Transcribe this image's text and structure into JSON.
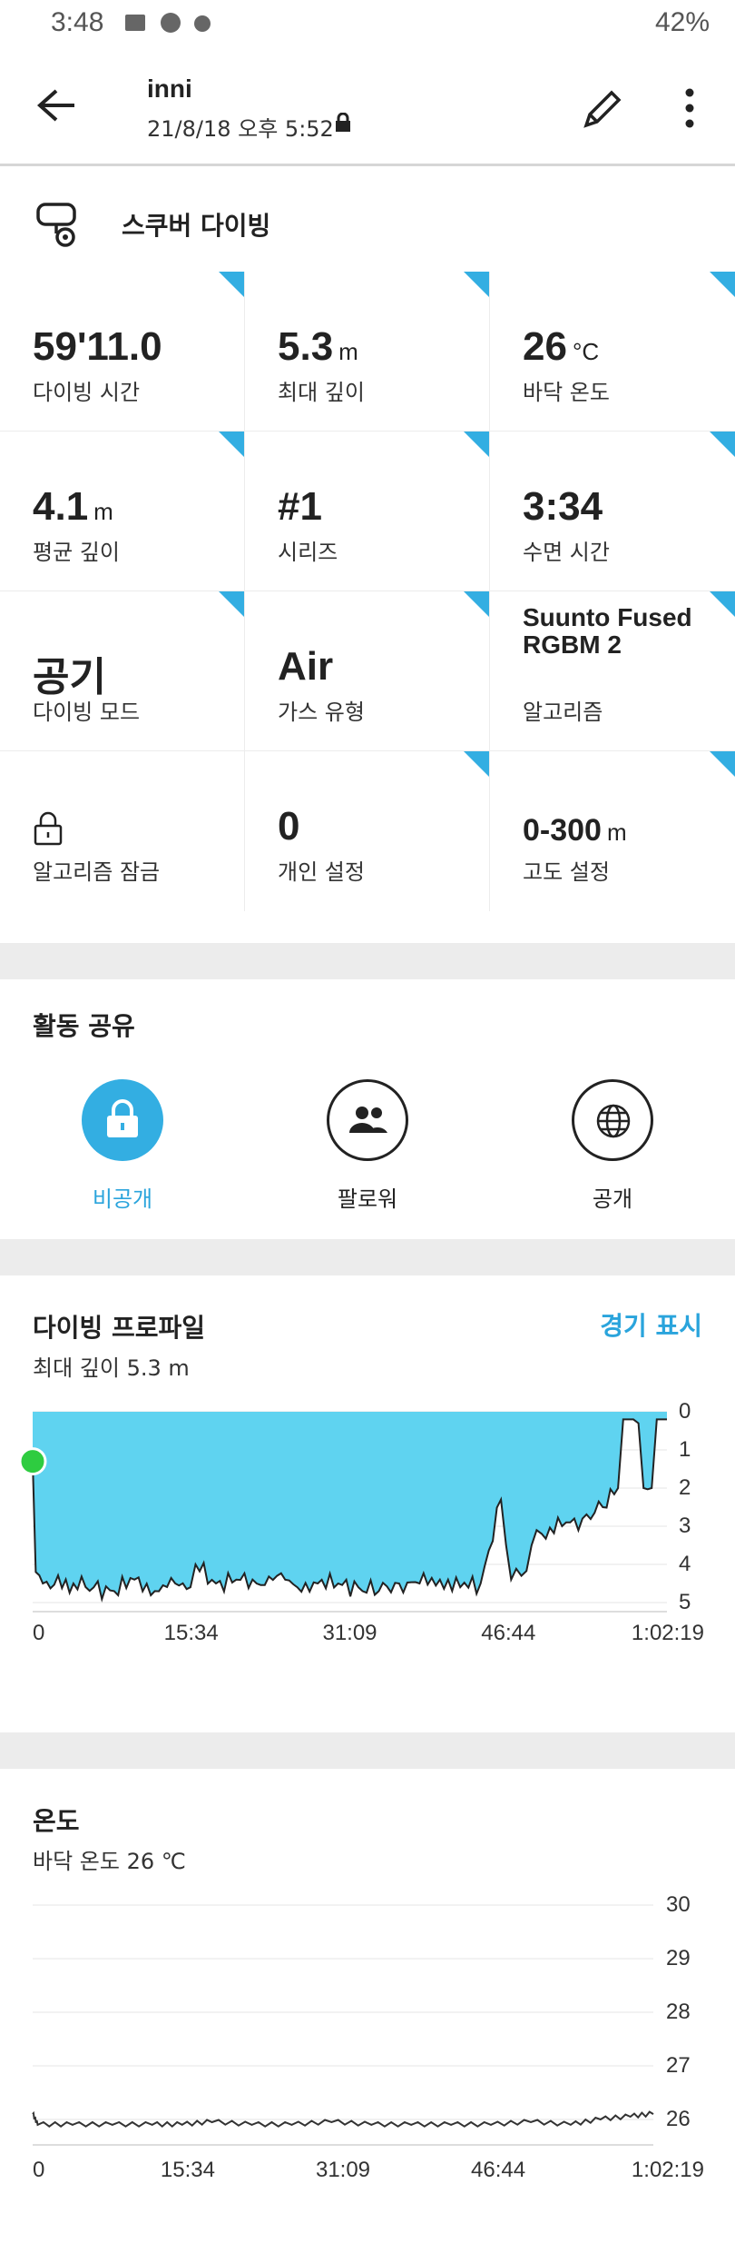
{
  "status_bar": {
    "time": "3:48",
    "battery": "42%"
  },
  "header": {
    "title": "inni",
    "subtitle": "21/8/18 오후 5:52"
  },
  "activity": {
    "name": "스쿠버 다이빙"
  },
  "stats": [
    {
      "value": "59'11.0",
      "unit": "",
      "label": "다이빙 시간"
    },
    {
      "value": "5.3",
      "unit": "m",
      "label": "최대 깊이"
    },
    {
      "value": "26",
      "unit": "°C",
      "label": "바닥 온도"
    },
    {
      "value": "4.1",
      "unit": "m",
      "label": "평균 깊이"
    },
    {
      "value": "#1",
      "unit": "",
      "label": "시리즈"
    },
    {
      "value": "3:34",
      "unit": "",
      "label": "수면 시간"
    },
    {
      "value": "공기",
      "unit": "",
      "label": "다이빙 모드"
    },
    {
      "value": "Air",
      "unit": "",
      "label": "가스 유형"
    },
    {
      "value": "Suunto Fused RGBM 2",
      "unit": "",
      "label": "알고리즘"
    },
    {
      "value": "",
      "unit": "",
      "label": "알고리즘 잠금"
    },
    {
      "value": "0",
      "unit": "",
      "label": "개인 설정"
    },
    {
      "value": "0-300",
      "unit": "m",
      "label": "고도 설정"
    }
  ],
  "share": {
    "title": "활동 공유",
    "options": [
      {
        "label": "비공개",
        "icon": "lock-icon",
        "selected": true
      },
      {
        "label": "팔로워",
        "icon": "people-icon",
        "selected": false
      },
      {
        "label": "공개",
        "icon": "globe-icon",
        "selected": false
      }
    ]
  },
  "dive_profile": {
    "title": "다이빙 프로파일",
    "subtitle": "최대 깊이 5.3 m",
    "action": "경기 표시"
  },
  "temperature": {
    "title": "온도",
    "subtitle": "바닥 온도 26 ℃"
  },
  "colors": {
    "accent": "#33aee2",
    "depth_fill": "#5fd3f0",
    "marker": "#2ecc40"
  },
  "chart_data": [
    {
      "type": "area",
      "title": "다이빙 프로파일",
      "x_ticks": [
        "0",
        "15:34",
        "31:09",
        "46:44",
        "1:02:19"
      ],
      "y_ticks": [
        "0",
        "1",
        "2",
        "3",
        "4",
        "5"
      ],
      "ylim": [
        5,
        0
      ],
      "x_minutes": [
        0,
        0.3,
        1,
        4,
        6,
        8,
        10,
        12,
        14,
        15.5,
        16,
        18,
        20,
        22,
        24,
        26,
        28,
        30,
        32,
        34,
        36,
        38,
        40,
        42,
        44,
        46,
        47,
        48,
        49,
        50,
        52,
        54,
        56,
        57.5,
        58,
        59,
        59.5,
        60,
        60.8,
        61.3,
        62.3
      ],
      "depth_m": [
        1.3,
        4.2,
        4.5,
        4.5,
        4.6,
        4.7,
        4.4,
        4.7,
        4.5,
        4.6,
        4.0,
        4.5,
        4.4,
        4.5,
        4.3,
        4.6,
        4.5,
        4.5,
        4.6,
        4.7,
        4.5,
        4.5,
        4.4,
        4.6,
        4.5,
        2.3,
        4.4,
        4.3,
        3.5,
        3.2,
        3.0,
        2.8,
        2.5,
        2.0,
        0.2,
        0.2,
        0.3,
        2.0,
        2.0,
        0.2,
        0.2
      ]
    },
    {
      "type": "line",
      "title": "온도",
      "x_ticks": [
        "0",
        "15:34",
        "31:09",
        "46:44",
        "1:02:19"
      ],
      "y_ticks": [
        "30",
        "29",
        "28",
        "27",
        "26"
      ],
      "ylim": [
        26,
        30
      ],
      "x_minutes": [
        0,
        0.5,
        4,
        8,
        12,
        15,
        18,
        22,
        26,
        30,
        34,
        38,
        42,
        46,
        50,
        54,
        57,
        60,
        62.3
      ],
      "temp_c": [
        26.1,
        25.9,
        25.9,
        25.9,
        25.9,
        25.9,
        25.95,
        25.9,
        25.9,
        25.95,
        25.9,
        25.9,
        25.9,
        25.9,
        25.95,
        25.9,
        26.0,
        26.05,
        26.1
      ]
    }
  ]
}
